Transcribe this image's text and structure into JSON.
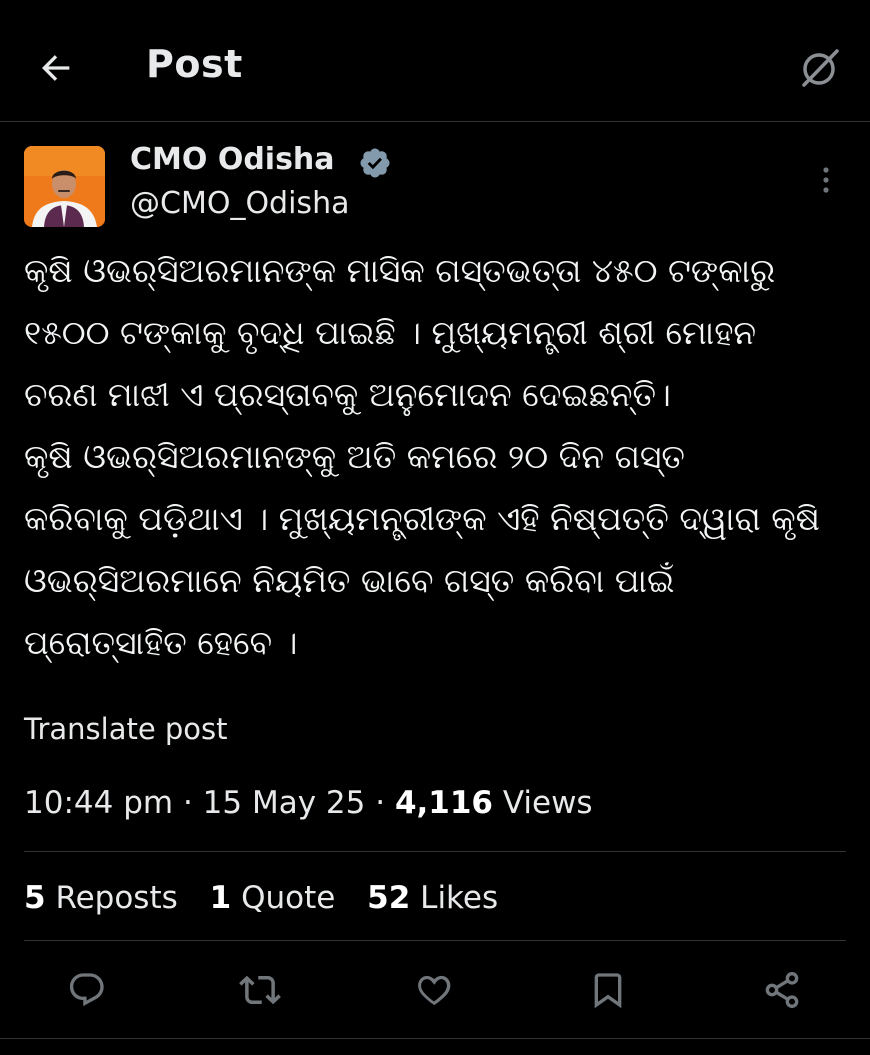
{
  "header": {
    "title": "Post",
    "back_icon": "arrow-left-icon",
    "grok_icon": "grok-icon"
  },
  "author": {
    "name": "CMO Odisha",
    "handle": "@CMO_Odisha",
    "verified_color": "#829aab",
    "avatar_bg": "#f07b1a"
  },
  "post": {
    "text": "କୃଷି ଓଭର୍‌ସିଅରମାନଙ୍କ ମାସିକ ଗସ୍ତଭତ୍ତା ୪୫୦ ଟଙ୍କାରୁ\n୧୫୦୦ ଟଙ୍କାକୁ ବୃଦ୍ଧି ପାଇଛି । ମୁଖ୍ୟମନ୍ତ୍ରୀ ଶ୍ରୀ ମୋହନ\nଚରଣ ମାଝୀ ଏ ପ୍ରସ୍ତାବକୁ ଅନୁମୋଦନ ଦେଇଛନ୍ତି।\nକୃଷି ଓଭର୍‌ସିଅରମାନଙ୍କୁ ଅତି କମରେ ୨୦ ଦିନ ଗସ୍ତ\nକରିବାକୁ ପଡ଼ିଥାଏ । ମୁଖ୍ୟମନ୍ତ୍ରୀଙ୍କ ଏହି ନିଷ୍ପତ୍ତି ଦ୍ୱାରା କୃଷି\nଓଭର୍‌ସିଅରମାନେ ନିୟମିତ ଭାବେ ଗସ୍ତ କରିବା ପାଇଁ\nପ୍ରୋତ୍ସାହିତ ହେବେ ।",
    "translate_label": "Translate post",
    "time": "10:44 pm",
    "date": "15 May 25",
    "views_count": "4,116",
    "views_label": "Views",
    "separator": "·"
  },
  "stats": {
    "reposts_count": "5",
    "reposts_label": "Reposts",
    "quotes_count": "1",
    "quotes_label": "Quote",
    "likes_count": "52",
    "likes_label": "Likes"
  },
  "actions": [
    {
      "icon": "reply-icon"
    },
    {
      "icon": "repost-icon"
    },
    {
      "icon": "like-icon"
    },
    {
      "icon": "bookmark-icon"
    },
    {
      "icon": "share-icon"
    }
  ],
  "colors": {
    "background": "#000000",
    "text": "#e7e9ea",
    "muted_icon": "#71767b",
    "divider": "#2f3336"
  }
}
